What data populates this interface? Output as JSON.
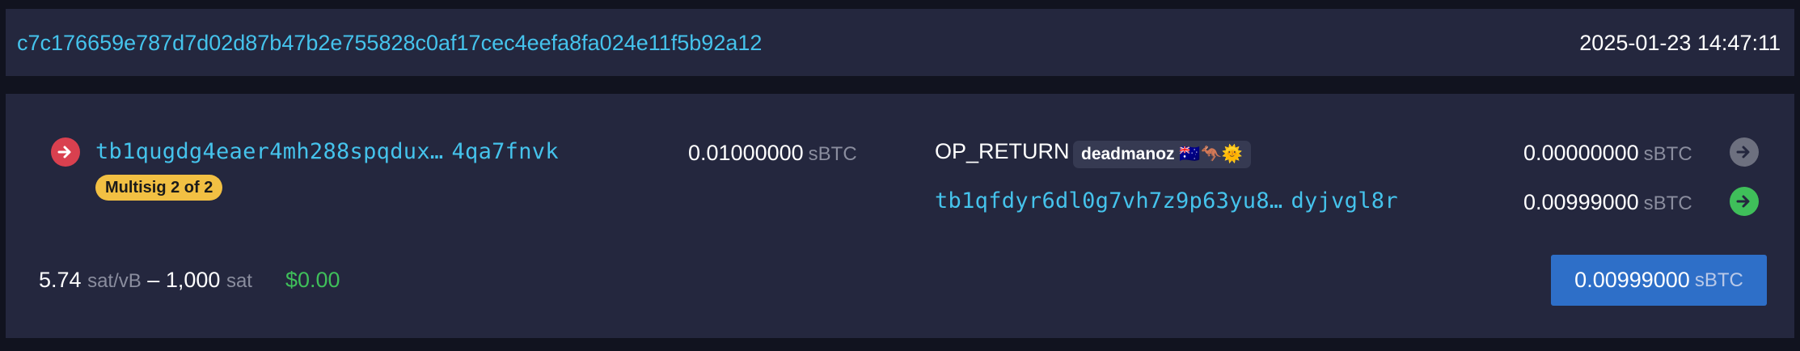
{
  "header": {
    "txid": "c7c176659e787d7d02d87b47b2e755828c0af17cec4eefa8fa024e11f5b92a12",
    "timestamp": "2025-01-23 14:47:11"
  },
  "inputs": [
    {
      "address_start": "tb1qugdg4eaer4mh288spqdux…",
      "address_end": "4qa7fnvk",
      "badge": "Multisig 2 of 2",
      "amount": "0.01000000",
      "unit": "sBTC",
      "icon": "arrow-right-circle-icon",
      "icon_color": "#d9404f"
    }
  ],
  "outputs": [
    {
      "label": "OP_RETURN",
      "tag": "deadmanoz 🇦🇺🦘🌞",
      "amount": "0.00000000",
      "unit": "sBTC",
      "icon": "arrow-right-circle-icon",
      "icon_color": "#6d707f"
    },
    {
      "address_start": "tb1qfdyr6dl0g7vh7z9p63yu8…",
      "address_end": "dyjvgl8r",
      "amount": "0.00999000",
      "unit": "sBTC",
      "icon": "arrow-right-circle-icon",
      "icon_color": "#3fbf5a"
    }
  ],
  "footer": {
    "fee_rate": "5.74",
    "fee_rate_unit": "sat/vB",
    "separator": "–",
    "fee": "1,000",
    "fee_unit": "sat",
    "fiat": "$0.00",
    "total": "0.00999000",
    "total_unit": "sBTC"
  }
}
